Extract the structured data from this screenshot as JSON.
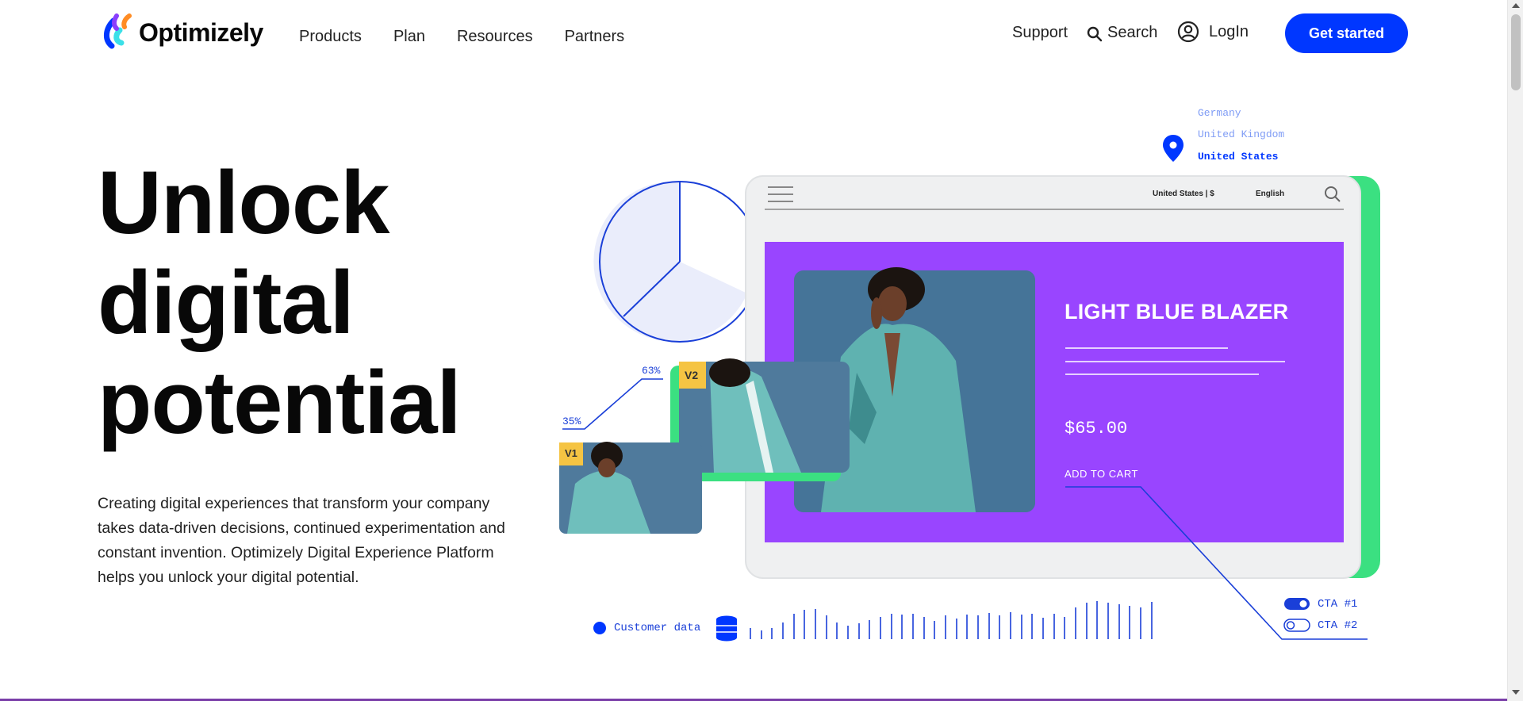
{
  "brand": {
    "name": "Optimizely"
  },
  "nav": {
    "items": [
      {
        "label": "Products"
      },
      {
        "label": "Plan"
      },
      {
        "label": "Resources"
      },
      {
        "label": "Partners"
      }
    ]
  },
  "utility": {
    "support_label": "Support",
    "search_label": "Search",
    "login_label": "LogIn",
    "cta_label": "Get started"
  },
  "hero": {
    "title_lines": [
      "Unlock",
      "digital",
      "potential"
    ],
    "copy": "Creating digital experiences that transform your company takes data-driven decisions, continued experimentation and constant invention. Optimizely Digital Experience Platform helps you unlock your digital potential."
  },
  "illustration": {
    "locations": [
      "Germany",
      "United Kingdom",
      "United States"
    ],
    "store_region": "United States | $",
    "store_language": "English",
    "product_name": "LIGHT BLUE BLAZER",
    "price": "$65.00",
    "add_to_cart": "ADD TO CART",
    "variant_a": "V1",
    "variant_b": "V2",
    "pct_a": "35%",
    "pct_b": "63%",
    "customer_data": "Customer data",
    "cta_1": "CTA #1",
    "cta_2": "CTA #2"
  },
  "colors": {
    "accent": "#0037ff",
    "purple": "#9945ff",
    "green": "#3be081",
    "yellow": "#f5c443",
    "teal": "#4a9a9c"
  },
  "icons": {
    "search": "search-icon",
    "user": "user-circle-icon",
    "location": "location-pin-icon",
    "menu": "hamburger-icon",
    "database": "database-icon"
  }
}
